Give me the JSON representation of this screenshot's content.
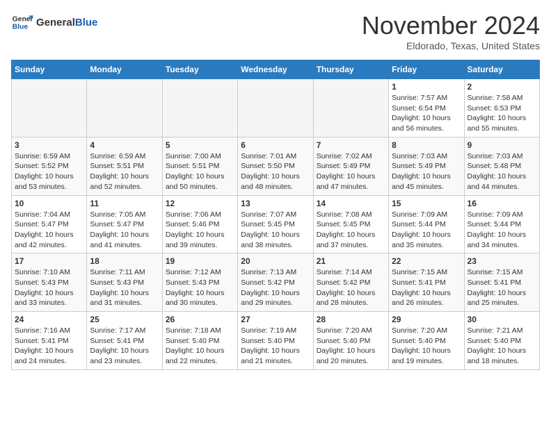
{
  "header": {
    "logo_line1": "General",
    "logo_line2": "Blue",
    "month_title": "November 2024",
    "location": "Eldorado, Texas, United States"
  },
  "days_of_week": [
    "Sunday",
    "Monday",
    "Tuesday",
    "Wednesday",
    "Thursday",
    "Friday",
    "Saturday"
  ],
  "weeks": [
    [
      {
        "day": "",
        "info": ""
      },
      {
        "day": "",
        "info": ""
      },
      {
        "day": "",
        "info": ""
      },
      {
        "day": "",
        "info": ""
      },
      {
        "day": "",
        "info": ""
      },
      {
        "day": "1",
        "info": "Sunrise: 7:57 AM\nSunset: 6:54 PM\nDaylight: 10 hours and 56 minutes."
      },
      {
        "day": "2",
        "info": "Sunrise: 7:58 AM\nSunset: 6:53 PM\nDaylight: 10 hours and 55 minutes."
      }
    ],
    [
      {
        "day": "3",
        "info": "Sunrise: 6:59 AM\nSunset: 5:52 PM\nDaylight: 10 hours and 53 minutes."
      },
      {
        "day": "4",
        "info": "Sunrise: 6:59 AM\nSunset: 5:51 PM\nDaylight: 10 hours and 52 minutes."
      },
      {
        "day": "5",
        "info": "Sunrise: 7:00 AM\nSunset: 5:51 PM\nDaylight: 10 hours and 50 minutes."
      },
      {
        "day": "6",
        "info": "Sunrise: 7:01 AM\nSunset: 5:50 PM\nDaylight: 10 hours and 48 minutes."
      },
      {
        "day": "7",
        "info": "Sunrise: 7:02 AM\nSunset: 5:49 PM\nDaylight: 10 hours and 47 minutes."
      },
      {
        "day": "8",
        "info": "Sunrise: 7:03 AM\nSunset: 5:49 PM\nDaylight: 10 hours and 45 minutes."
      },
      {
        "day": "9",
        "info": "Sunrise: 7:03 AM\nSunset: 5:48 PM\nDaylight: 10 hours and 44 minutes."
      }
    ],
    [
      {
        "day": "10",
        "info": "Sunrise: 7:04 AM\nSunset: 5:47 PM\nDaylight: 10 hours and 42 minutes."
      },
      {
        "day": "11",
        "info": "Sunrise: 7:05 AM\nSunset: 5:47 PM\nDaylight: 10 hours and 41 minutes."
      },
      {
        "day": "12",
        "info": "Sunrise: 7:06 AM\nSunset: 5:46 PM\nDaylight: 10 hours and 39 minutes."
      },
      {
        "day": "13",
        "info": "Sunrise: 7:07 AM\nSunset: 5:45 PM\nDaylight: 10 hours and 38 minutes."
      },
      {
        "day": "14",
        "info": "Sunrise: 7:08 AM\nSunset: 5:45 PM\nDaylight: 10 hours and 37 minutes."
      },
      {
        "day": "15",
        "info": "Sunrise: 7:09 AM\nSunset: 5:44 PM\nDaylight: 10 hours and 35 minutes."
      },
      {
        "day": "16",
        "info": "Sunrise: 7:09 AM\nSunset: 5:44 PM\nDaylight: 10 hours and 34 minutes."
      }
    ],
    [
      {
        "day": "17",
        "info": "Sunrise: 7:10 AM\nSunset: 5:43 PM\nDaylight: 10 hours and 33 minutes."
      },
      {
        "day": "18",
        "info": "Sunrise: 7:11 AM\nSunset: 5:43 PM\nDaylight: 10 hours and 31 minutes."
      },
      {
        "day": "19",
        "info": "Sunrise: 7:12 AM\nSunset: 5:43 PM\nDaylight: 10 hours and 30 minutes."
      },
      {
        "day": "20",
        "info": "Sunrise: 7:13 AM\nSunset: 5:42 PM\nDaylight: 10 hours and 29 minutes."
      },
      {
        "day": "21",
        "info": "Sunrise: 7:14 AM\nSunset: 5:42 PM\nDaylight: 10 hours and 28 minutes."
      },
      {
        "day": "22",
        "info": "Sunrise: 7:15 AM\nSunset: 5:41 PM\nDaylight: 10 hours and 26 minutes."
      },
      {
        "day": "23",
        "info": "Sunrise: 7:15 AM\nSunset: 5:41 PM\nDaylight: 10 hours and 25 minutes."
      }
    ],
    [
      {
        "day": "24",
        "info": "Sunrise: 7:16 AM\nSunset: 5:41 PM\nDaylight: 10 hours and 24 minutes."
      },
      {
        "day": "25",
        "info": "Sunrise: 7:17 AM\nSunset: 5:41 PM\nDaylight: 10 hours and 23 minutes."
      },
      {
        "day": "26",
        "info": "Sunrise: 7:18 AM\nSunset: 5:40 PM\nDaylight: 10 hours and 22 minutes."
      },
      {
        "day": "27",
        "info": "Sunrise: 7:19 AM\nSunset: 5:40 PM\nDaylight: 10 hours and 21 minutes."
      },
      {
        "day": "28",
        "info": "Sunrise: 7:20 AM\nSunset: 5:40 PM\nDaylight: 10 hours and 20 minutes."
      },
      {
        "day": "29",
        "info": "Sunrise: 7:20 AM\nSunset: 5:40 PM\nDaylight: 10 hours and 19 minutes."
      },
      {
        "day": "30",
        "info": "Sunrise: 7:21 AM\nSunset: 5:40 PM\nDaylight: 10 hours and 18 minutes."
      }
    ]
  ]
}
